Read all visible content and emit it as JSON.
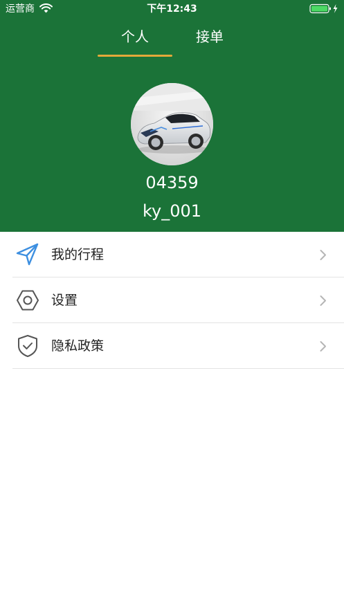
{
  "status_bar": {
    "carrier": "运营商",
    "time": "下午12:43",
    "icons": [
      "wifi-icon",
      "battery-icon",
      "charging-bolt-icon"
    ]
  },
  "tabs": [
    {
      "label": "个人",
      "selected": true
    },
    {
      "label": "接单",
      "selected": false
    }
  ],
  "profile": {
    "avatar": "car-avatar",
    "code": "04359",
    "name": "ky_001"
  },
  "menu": [
    {
      "label": "我的行程",
      "icon": "send-arrow-icon"
    },
    {
      "label": "设置",
      "icon": "hexagon-settings-icon"
    },
    {
      "label": "隐私政策",
      "icon": "shield-check-icon"
    }
  ],
  "colors": {
    "header_green": "#1b7338",
    "tab_indicator": "#e4a93a",
    "trip_icon_blue": "#3d8fe0",
    "battery_green": "#4cd964"
  }
}
